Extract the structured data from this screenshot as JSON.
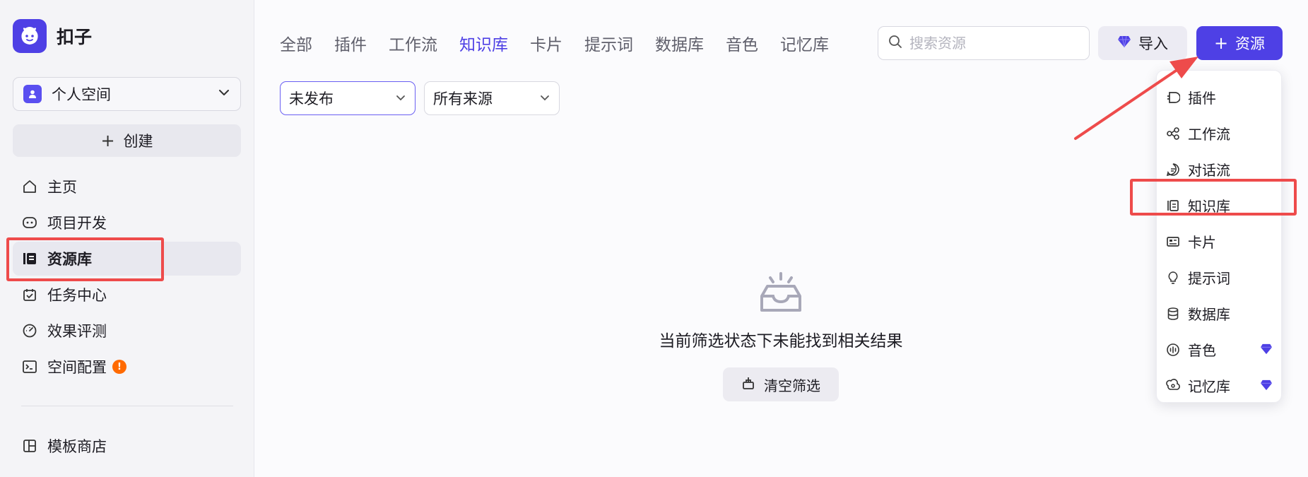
{
  "brand": {
    "name": "扣子"
  },
  "space": {
    "label": "个人空间"
  },
  "create": {
    "label": "创建"
  },
  "nav": [
    {
      "label": "主页",
      "icon": "home-icon"
    },
    {
      "label": "项目开发",
      "icon": "robot-icon"
    },
    {
      "label": "资源库",
      "icon": "library-icon",
      "active": true
    },
    {
      "label": "任务中心",
      "icon": "task-icon"
    },
    {
      "label": "效果评测",
      "icon": "gauge-icon"
    },
    {
      "label": "空间配置",
      "icon": "terminal-icon",
      "badge": "!"
    }
  ],
  "nav_bottom": [
    {
      "label": "模板商店",
      "icon": "template-icon"
    }
  ],
  "tabs": [
    {
      "label": "全部"
    },
    {
      "label": "插件"
    },
    {
      "label": "工作流"
    },
    {
      "label": "知识库",
      "active": true
    },
    {
      "label": "卡片"
    },
    {
      "label": "提示词"
    },
    {
      "label": "数据库"
    },
    {
      "label": "音色"
    },
    {
      "label": "记忆库"
    }
  ],
  "search": {
    "placeholder": "搜索资源"
  },
  "import": {
    "label": "导入"
  },
  "resource_button": {
    "label": "资源"
  },
  "filters": {
    "status": "未发布",
    "source": "所有来源"
  },
  "empty": {
    "message": "当前筛选状态下未能找到相关结果",
    "clear_label": "清空筛选"
  },
  "menu": [
    {
      "label": "插件",
      "icon": "plugin-icon"
    },
    {
      "label": "工作流",
      "icon": "workflow-icon"
    },
    {
      "label": "对话流",
      "icon": "chat-flow-icon"
    },
    {
      "label": "知识库",
      "icon": "knowledge-icon",
      "highlighted": true
    },
    {
      "label": "卡片",
      "icon": "card-icon"
    },
    {
      "label": "提示词",
      "icon": "bulb-icon"
    },
    {
      "label": "数据库",
      "icon": "database-icon"
    },
    {
      "label": "音色",
      "icon": "voice-icon",
      "premium": true
    },
    {
      "label": "记忆库",
      "icon": "memory-icon",
      "premium": true
    }
  ],
  "colors": {
    "accent": "#4e40e5",
    "highlight": "#ee4b4b",
    "badge": "#ff6a00"
  }
}
